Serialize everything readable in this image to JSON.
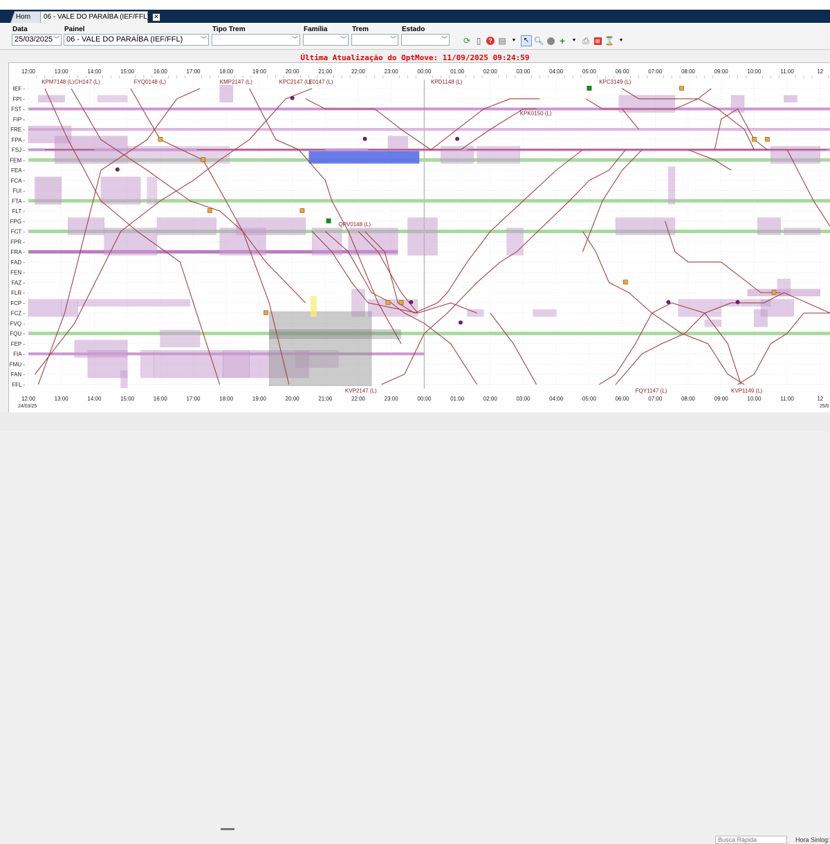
{
  "tabs": [
    {
      "label": "Hom"
    },
    {
      "label": "06 - VALE DO PARAÍBA (IEF/FFL)"
    }
  ],
  "filters": {
    "data": {
      "label": "Data",
      "value": "25/03/2025"
    },
    "painel": {
      "label": "Painel",
      "value": "06 - VALE DO PARAÍBA (IEF/FFL)"
    },
    "tipo_trem": {
      "label": "Tipo Trem",
      "value": ""
    },
    "familia": {
      "label": "Família",
      "value": ""
    },
    "trem": {
      "label": "Trem",
      "value": ""
    },
    "estado": {
      "label": "Estado",
      "value": ""
    }
  },
  "toolbar_icons": [
    "refresh-icon",
    "new-document-icon",
    "help-icon",
    "report-icon",
    "select-pointer-icon",
    "zoom-icon",
    "record-icon",
    "add-icon",
    "print-icon",
    "close-panel-icon",
    "hourglass-icon"
  ],
  "status_text": "Última Atualização do OptMove: 11/09/2025 09:24:59",
  "chart_data": {
    "type": "train-graph",
    "time_ticks_top": [
      "12:00",
      "13:00",
      "14:00",
      "15:00",
      "16:00",
      "17:00",
      "18:00",
      "19:00",
      "20:00",
      "21:00",
      "22:00",
      "23:00",
      "00:00",
      "01:00",
      "02:00",
      "03:00",
      "04:00",
      "05:00",
      "06:00",
      "07:00",
      "08:00",
      "09:00",
      "10:00",
      "11:00",
      "12"
    ],
    "time_ticks_bottom": [
      "12:00",
      "13:00",
      "14:00",
      "15:00",
      "16:00",
      "17:00",
      "18:00",
      "19:00",
      "20:00",
      "21:00",
      "22:00",
      "23:00",
      "00:00",
      "01:00",
      "02:00",
      "03:00",
      "04:00",
      "05:00",
      "06:00",
      "07:00",
      "08:00",
      "09:00",
      "10:00",
      "11:00",
      "12"
    ],
    "date_start": "24/03/25",
    "date_end": "25/0",
    "stations": [
      "IEF",
      "FPI",
      "FST",
      "FIP",
      "FRE",
      "FPA",
      "FSJ",
      "FEM",
      "FEA",
      "FCA",
      "FUI",
      "FTA",
      "FLT",
      "FPG",
      "FCT",
      "FPR",
      "FRA",
      "FAD",
      "FEN",
      "FAZ",
      "FLR",
      "FCP",
      "FCZ",
      "FVQ",
      "FQU",
      "FEP",
      "FIA",
      "FMU",
      "FAN",
      "FFL"
    ],
    "train_labels": [
      "KPM7148 (L)",
      "CH147 (L)",
      "FYQ0148 (L)",
      "KMP2147 (L)",
      "KPC2147 (L)",
      "E0147 (L)",
      "KPD1148 (L)",
      "KPC3149 (L)",
      "KPK0150 (L)",
      "QPV0148 (L)",
      "KVP2147 (L)",
      "FQY1147 (L)",
      "KVP1149 (L)"
    ],
    "colors": {
      "occupation": "#c89fd0",
      "track": "#a8d8a0",
      "train_line": "#a2413f",
      "highlight": "#5a6ee8",
      "current_time": "#bbbbbb",
      "marker_orange": "#f0a63a",
      "marker_purple": "#6a1f6a",
      "marker_green": "#1a8a1a"
    }
  },
  "busca_rapida": "Busca Rápida",
  "hora_label": "Hora Sinlog:"
}
